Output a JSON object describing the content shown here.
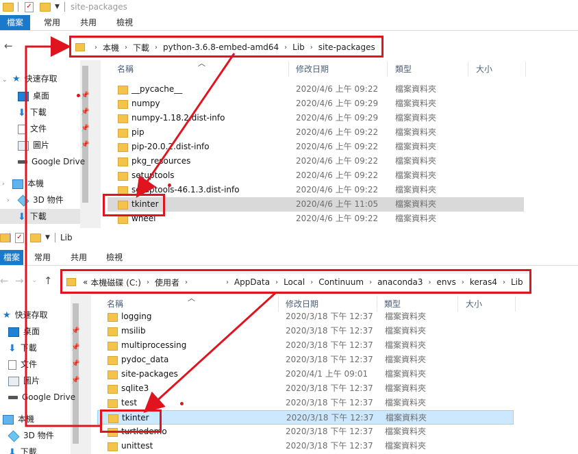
{
  "window1": {
    "title": "site-packages",
    "ribbon_tabs": [
      "檔案",
      "常用",
      "共用",
      "檢視"
    ],
    "breadcrumb": [
      "本機",
      "下載",
      "python-3.6.8-embed-amd64",
      "Lib",
      "site-packages"
    ],
    "columns": {
      "name": "名稱",
      "date": "修改日期",
      "type": "類型",
      "size": "大小"
    },
    "nav": {
      "quick_access": "快速存取",
      "desktop": "桌面",
      "downloads": "下載",
      "documents": "文件",
      "pictures": "圖片",
      "gdrive": "Google Drive",
      "this_pc": "本機",
      "objects3d": "3D 物件",
      "downloads2": "下載"
    },
    "files": [
      {
        "name": "__pycache__",
        "date": "2020/4/6 上午 09:22",
        "type": "檔案資料夾"
      },
      {
        "name": "numpy",
        "date": "2020/4/6 上午 09:29",
        "type": "檔案資料夾"
      },
      {
        "name": "numpy-1.18.2.dist-info",
        "date": "2020/4/6 上午 09:29",
        "type": "檔案資料夾"
      },
      {
        "name": "pip",
        "date": "2020/4/6 上午 09:22",
        "type": "檔案資料夾"
      },
      {
        "name": "pip-20.0.2.dist-info",
        "date": "2020/4/6 上午 09:22",
        "type": "檔案資料夾"
      },
      {
        "name": "pkg_resources",
        "date": "2020/4/6 上午 09:22",
        "type": "檔案資料夾"
      },
      {
        "name": "setuptools",
        "date": "2020/4/6 上午 09:22",
        "type": "檔案資料夾"
      },
      {
        "name": "setuptools-46.1.3.dist-info",
        "date": "2020/4/6 上午 09:22",
        "type": "檔案資料夾"
      },
      {
        "name": "tkinter",
        "date": "2020/4/6 上午 11:05",
        "type": "檔案資料夾"
      },
      {
        "name": "wheel",
        "date": "2020/4/6 上午 09:22",
        "type": "檔案資料夾"
      }
    ]
  },
  "window2": {
    "title": "Lib",
    "ribbon_tabs": [
      "檔案",
      "常用",
      "共用",
      "檢視"
    ],
    "breadcrumb_prefix": "«",
    "breadcrumb": [
      "本機磁碟 (C:)",
      "使用者",
      "",
      "AppData",
      "Local",
      "Continuum",
      "anaconda3",
      "envs",
      "keras4",
      "Lib"
    ],
    "columns": {
      "name": "名稱",
      "date": "修改日期",
      "type": "類型",
      "size": "大小"
    },
    "nav": {
      "quick_access": "快速存取",
      "desktop": "桌面",
      "downloads": "下載",
      "documents": "文件",
      "pictures": "圖片",
      "gdrive": "Google Drive",
      "this_pc": "本機",
      "objects3d": "3D 物件",
      "downloads2": "下載"
    },
    "files": [
      {
        "name": "logging",
        "date": "2020/3/18 下午 12:37",
        "type": "檔案資料夾"
      },
      {
        "name": "msilib",
        "date": "2020/3/18 下午 12:37",
        "type": "檔案資料夾"
      },
      {
        "name": "multiprocessing",
        "date": "2020/3/18 下午 12:37",
        "type": "檔案資料夾"
      },
      {
        "name": "pydoc_data",
        "date": "2020/3/18 下午 12:37",
        "type": "檔案資料夾"
      },
      {
        "name": "site-packages",
        "date": "2020/4/1 上午 09:01",
        "type": "檔案資料夾"
      },
      {
        "name": "sqlite3",
        "date": "2020/3/18 下午 12:37",
        "type": "檔案資料夾"
      },
      {
        "name": "test",
        "date": "2020/3/18 下午 12:37",
        "type": "檔案資料夾"
      },
      {
        "name": "tkinter",
        "date": "2020/3/18 下午 12:37",
        "type": "檔案資料夾"
      },
      {
        "name": "turtledemo",
        "date": "2020/3/18 下午 12:37",
        "type": "檔案資料夾"
      },
      {
        "name": "unittest",
        "date": "2020/3/18 下午 12:37",
        "type": "檔案資料夾"
      }
    ]
  },
  "colors": {
    "annotation_red": "#e0141e",
    "ribbon_file_blue": "#1979ca",
    "selection_gray": "#d9d9d9",
    "selection_blue": "#cce8ff"
  }
}
